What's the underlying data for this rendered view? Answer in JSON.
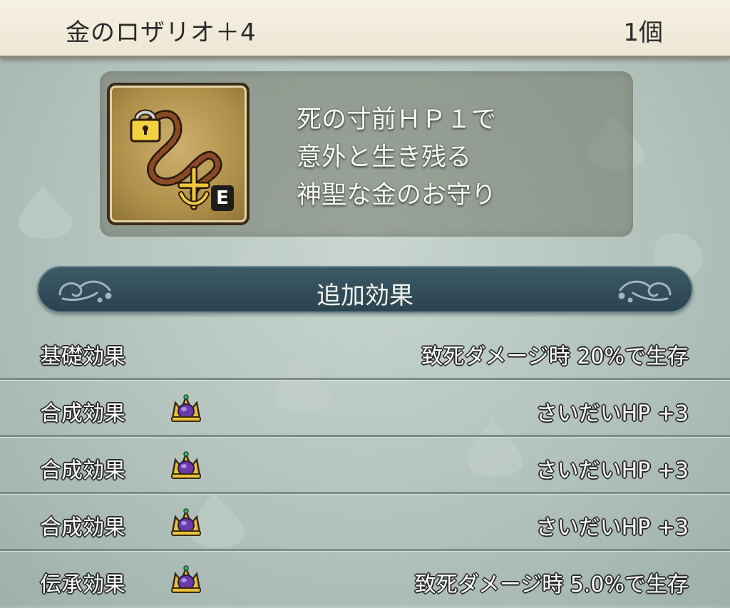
{
  "header": {
    "item_name": "金のロザリオ＋4",
    "count": "1個"
  },
  "item": {
    "icon": "gold-rosary-icon",
    "equipped_badge": "E",
    "description_lines": [
      "死の寸前ＨＰ１で",
      "意外と生き残る",
      "神聖な金のお守り"
    ]
  },
  "section": {
    "title": "追加効果"
  },
  "effects": [
    {
      "label": "基礎効果",
      "icon": null,
      "value": "致死ダメージ時  20%で生存"
    },
    {
      "label": "合成効果",
      "icon": "crown-icon",
      "value": "さいだいHP  +3"
    },
    {
      "label": "合成効果",
      "icon": "crown-icon",
      "value": "さいだいHP  +3"
    },
    {
      "label": "合成効果",
      "icon": "crown-icon",
      "value": "さいだいHP  +3"
    },
    {
      "label": "伝承効果",
      "icon": "crown-icon",
      "value": "致死ダメージ時  5.0%で生存"
    }
  ],
  "colors": {
    "header_bg": "#efe9d6",
    "section_bar": "#2f4a55",
    "icon_gold": "#c6a75f"
  }
}
